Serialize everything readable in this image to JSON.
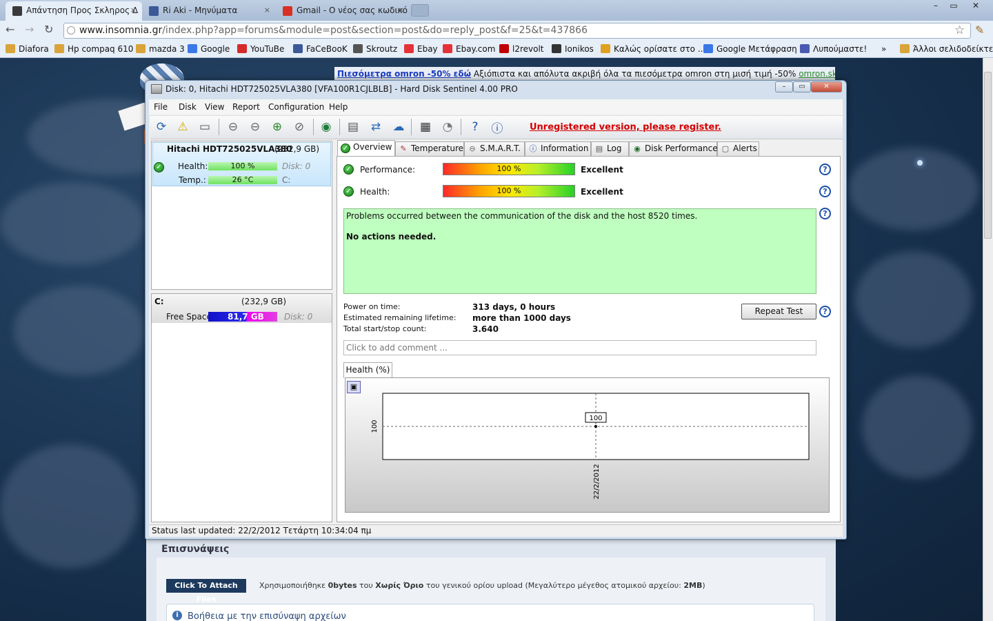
{
  "browser": {
    "tabs": [
      {
        "title": "Απάντηση Προς Σκληρος Δ",
        "close": "×"
      },
      {
        "title": "Ri Aki - Μηνύματα",
        "close": "×"
      },
      {
        "title": "Gmail - Ο νέος σας κωδικό",
        "close": "×"
      }
    ],
    "window_controls": {
      "minimize": "–",
      "maximize": "▭",
      "close": "✕"
    },
    "url_host": "www.insomnia.gr",
    "url_path": "/index.php?app=forums&module=post&section=post&do=reply_post&f=25&t=437866",
    "bookmarks": [
      {
        "label": "Diafora",
        "color": "#d9a43a"
      },
      {
        "label": "Hp compaq 610",
        "color": "#d9a43a"
      },
      {
        "label": "mazda 3",
        "color": "#d9a43a"
      },
      {
        "label": "Google",
        "color": "#3b78e7"
      },
      {
        "label": "YouTuBe",
        "color": "#d62a2a"
      },
      {
        "label": "FaCeBooK",
        "color": "#3b5998"
      },
      {
        "label": "Skroutz",
        "color": "#555555"
      },
      {
        "label": "Ebay",
        "color": "#e53238"
      },
      {
        "label": "Ebay.com",
        "color": "#e53238"
      },
      {
        "label": "l2revolt",
        "color": "#c00000"
      },
      {
        "label": "Ionikos",
        "color": "#333333"
      },
      {
        "label": "Καλώς ορίσατε στο ...",
        "color": "#e0a020"
      },
      {
        "label": "Google Μετάφραση",
        "color": "#3b78e7"
      },
      {
        "label": "Λυπούμαστε!",
        "color": "#4a5ab0"
      }
    ],
    "bookmarks_overflow": "»",
    "other_bookmarks": "Άλλοι σελιδοδείκτες"
  },
  "page": {
    "ad_link": "Πιεσόμετρα omron -50% εδώ",
    "ad_text": " Αξιόπιστα και απόλυτα ακριβή όλα τα πιεσόμετρα omron στη μισή τιμή -50% ",
    "ad_domain": "omron.skroutzsto",
    "attachments_title": "Επισυνάψεις",
    "attach_button": "Click To Attach Files",
    "attach_info_1": "Χρησιμοποιήθηκε ",
    "attach_info_bytes": "0bytes",
    "attach_info_2": " του ",
    "attach_info_limit": "Χωρίς Όριο",
    "attach_info_3": " του γενικού ορίου upload (Μεγαλύτερο μέγεθος ατομικού αρχείου: ",
    "attach_info_max": "2MB",
    "attach_info_4": ")",
    "help_text": "Βοήθεια με την επισύναψη αρχείων"
  },
  "hds": {
    "title": "Disk: 0, Hitachi HDT725025VLA380 [VFA100R1CJLBLB]  -  Hard Disk Sentinel 4.00 PRO",
    "menu": [
      "File",
      "Disk",
      "View",
      "Report",
      "Configuration",
      "Help"
    ],
    "unregistered": "Unregistered version, please register.",
    "disk": {
      "name": "Hitachi HDT725025VLA380",
      "size": "(232,9 GB)",
      "health_label": "Health:",
      "health_value": "100 %",
      "disk_ref": "Disk: 0",
      "temp_label": "Temp.:",
      "temp_value": "26 °C",
      "drive_ref": "C:"
    },
    "drive": {
      "letter": "C:",
      "size": "(232,9 GB)",
      "free_label": "Free Space",
      "free_value": "81,7 GB",
      "disk_ref": "Disk: 0"
    },
    "tabs": [
      "Overview",
      "Temperature",
      "S.M.A.R.T.",
      "Information",
      "Log",
      "Disk Performance",
      "Alerts"
    ],
    "overview": {
      "performance_label": "Performance:",
      "performance_value": "100 %",
      "performance_pct": 100,
      "performance_rating": "Excellent",
      "health_label": "Health:",
      "health_value": "100 %",
      "health_pct": 100,
      "health_rating": "Excellent",
      "message": "Problems occurred between the communication of the disk and the host 8520 times.",
      "action": "No actions needed.",
      "power_on_label": "Power on time:",
      "power_on_value": "313 days, 0 hours",
      "lifetime_label": "Estimated remaining lifetime:",
      "lifetime_value": "more than 1000 days",
      "startstop_label": "Total start/stop count:",
      "startstop_value": "3.640",
      "repeat_button": "Repeat Test",
      "comment_placeholder": "Click to add comment ..."
    },
    "status": "Status last updated: 22/2/2012 Τετάρτη 10:34:04 πμ"
  },
  "chart_data": {
    "type": "line",
    "tab_label": "Health (%)",
    "x": [
      "22/2/2012"
    ],
    "series": [
      {
        "values": [
          100
        ]
      }
    ],
    "y_tick_label": "100",
    "data_label": "100",
    "grid": true
  },
  "colors": {
    "accent_red": "#d40000",
    "ok_green": "#137a13",
    "link_blue": "#1a3bbf"
  }
}
